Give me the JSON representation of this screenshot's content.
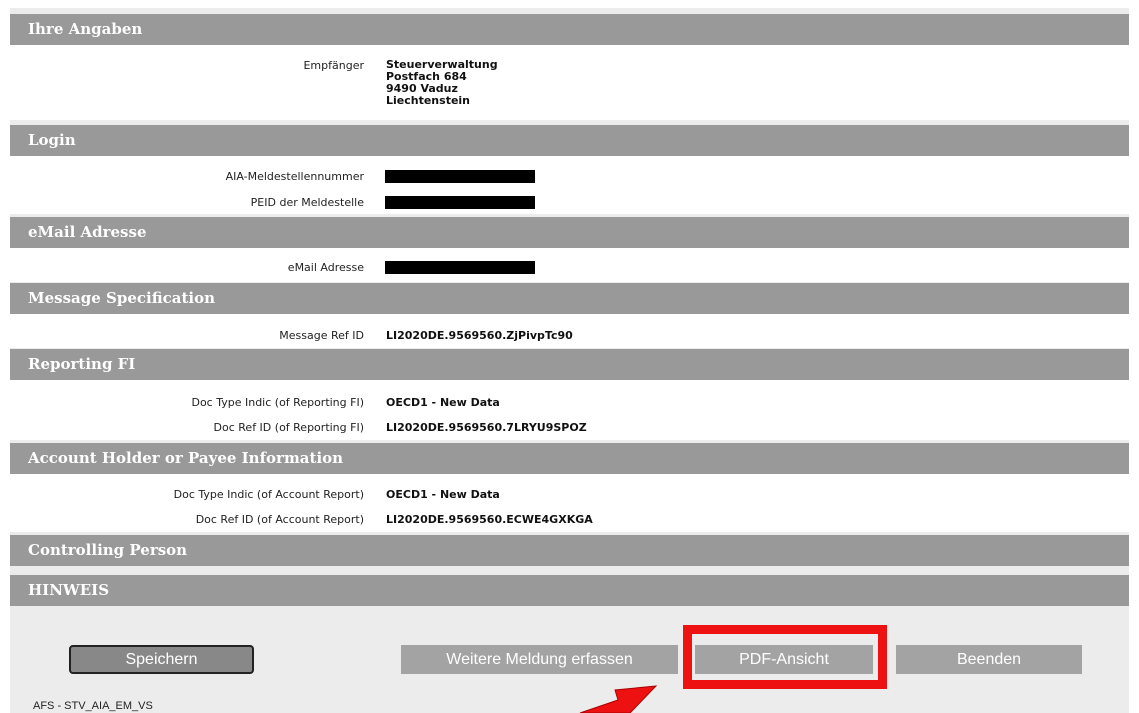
{
  "sections": {
    "ihre_angaben": {
      "title": "Ihre Angaben",
      "empfaenger_label": "Empfänger",
      "empfaenger_lines": [
        "Steuerverwaltung",
        "Postfach 684",
        "9490 Vaduz",
        "Liechtenstein"
      ]
    },
    "login": {
      "title": "Login",
      "meldestellennummer_label": "AIA-Meldestellennummer",
      "peid_label": "PEID der Meldestelle"
    },
    "email": {
      "title": "eMail Adresse",
      "email_label": "eMail Adresse"
    },
    "message_spec": {
      "title": "Message Specification",
      "ref_id_label": "Message Ref ID",
      "ref_id_value": "LI2020DE.9569560.ZjPivpTc90"
    },
    "reporting_fi": {
      "title": "Reporting FI",
      "doc_type_label": "Doc Type Indic (of Reporting FI)",
      "doc_type_value": "OECD1 - New Data",
      "doc_ref_label": "Doc Ref ID (of Reporting FI)",
      "doc_ref_value": "LI2020DE.9569560.7LRYU9SPOZ"
    },
    "account_holder": {
      "title": "Account Holder or Payee Information",
      "doc_type_label": "Doc Type Indic (of Account Report)",
      "doc_type_value": "OECD1 - New Data",
      "doc_ref_label": "Doc Ref ID (of Account Report)",
      "doc_ref_value": "LI2020DE.9569560.ECWE4GXKGA"
    },
    "controlling_person": {
      "title": "Controlling Person"
    },
    "hinweis": {
      "title": "HINWEIS"
    }
  },
  "buttons": {
    "save": "Speichern",
    "more": "Weitere Meldung erfassen",
    "pdf": "PDF-Ansicht",
    "end": "Beenden"
  },
  "footer": {
    "text": "AFS - STV_AIA_EM_VS"
  },
  "colors": {
    "header_bg": "#999999",
    "highlight": "#ee1111",
    "button_bg": "#a3a3a3"
  }
}
